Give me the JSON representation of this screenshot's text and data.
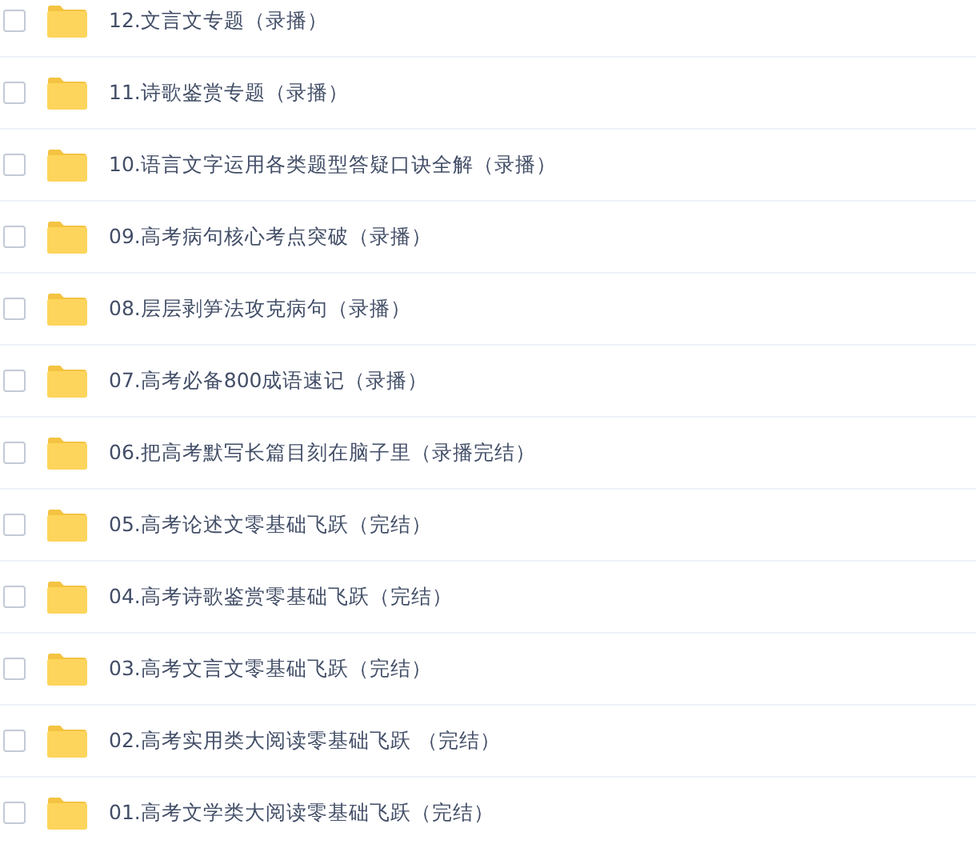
{
  "files": [
    {
      "name": "12.文言文专题（录播）",
      "checked": false
    },
    {
      "name": "11.诗歌鉴赏专题（录播）",
      "checked": false
    },
    {
      "name": "10.语言文字运用各类题型答疑口诀全解（录播）",
      "checked": false
    },
    {
      "name": "09.高考病句核心考点突破（录播）",
      "checked": false
    },
    {
      "name": "08.层层剥笋法攻克病句（录播）",
      "checked": false
    },
    {
      "name": "07.高考必备800成语速记（录播）",
      "checked": false
    },
    {
      "name": "06.把高考默写长篇目刻在脑子里（录播完结）",
      "checked": false
    },
    {
      "name": "05.高考论述文零基础飞跃（完结）",
      "checked": false
    },
    {
      "name": "04.高考诗歌鉴赏零基础飞跃（完结）",
      "checked": false
    },
    {
      "name": "03.高考文言文零基础飞跃（完结）",
      "checked": false
    },
    {
      "name": "02.高考实用类大阅读零基础飞跃 （完结）",
      "checked": false
    },
    {
      "name": "01.高考文学类大阅读零基础飞跃（完结）",
      "checked": false
    }
  ]
}
